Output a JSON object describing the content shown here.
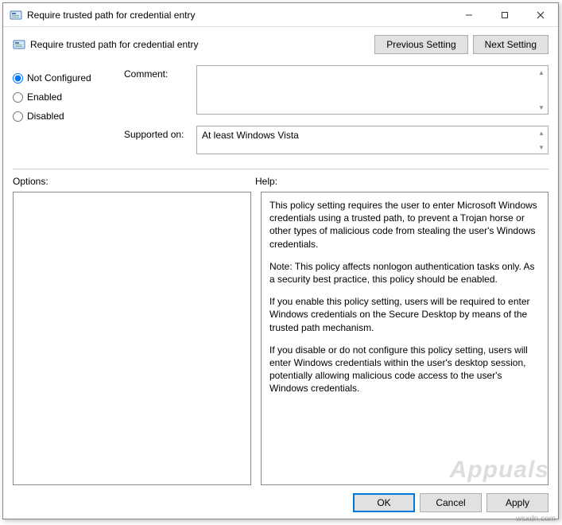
{
  "window": {
    "title": "Require trusted path for credential entry"
  },
  "header": {
    "subtitle": "Require trusted path for credential entry",
    "prev": "Previous Setting",
    "next": "Next Setting"
  },
  "state": {
    "options": [
      {
        "label": "Not Configured",
        "value": "not_configured"
      },
      {
        "label": "Enabled",
        "value": "enabled"
      },
      {
        "label": "Disabled",
        "value": "disabled"
      }
    ],
    "selected": "not_configured"
  },
  "fields": {
    "comment_label": "Comment:",
    "comment_value": "",
    "supported_label": "Supported on:",
    "supported_value": "At least Windows Vista"
  },
  "panes": {
    "options_label": "Options:",
    "help_label": "Help:"
  },
  "help": {
    "paragraphs": [
      "This policy setting requires the user to enter Microsoft Windows credentials using a trusted path, to prevent a Trojan horse or other types of malicious code from stealing the user's Windows credentials.",
      "Note: This policy affects nonlogon authentication tasks only. As a security best practice, this policy should be enabled.",
      "If you enable this policy setting, users will be required to enter Windows credentials on the Secure Desktop by means of the trusted path mechanism.",
      "If you disable or do not configure this policy setting, users will enter Windows credentials within the user's desktop session, potentially allowing malicious code access to the user's Windows credentials."
    ]
  },
  "footer": {
    "ok": "OK",
    "cancel": "Cancel",
    "apply": "Apply"
  },
  "watermark": {
    "brand": "Appuals",
    "source": "wsxdn.com"
  }
}
